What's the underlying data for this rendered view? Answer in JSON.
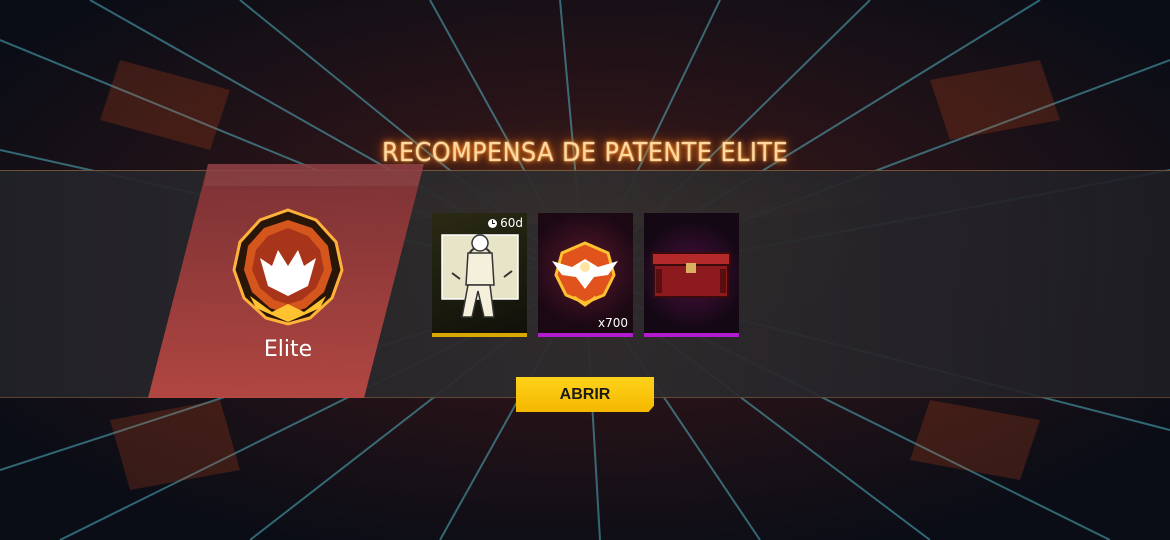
{
  "screen": {
    "title": "RECOMPENSA DE PATENTE ELITE"
  },
  "rank": {
    "name": "Elite",
    "badge_icon": "elite-rank-badge-icon"
  },
  "rewards": [
    {
      "icon": "emote-graffiti-icon",
      "duration": "60d",
      "rarity_color": "#d9a800"
    },
    {
      "icon": "eagle-emblem-icon",
      "quantity": "x700",
      "rarity_color": "#b21ccf"
    },
    {
      "icon": "red-crate-icon",
      "rarity_color": "#b21ccf"
    }
  ],
  "open_button": {
    "label": "ABRIR",
    "color": "#f5b800"
  }
}
